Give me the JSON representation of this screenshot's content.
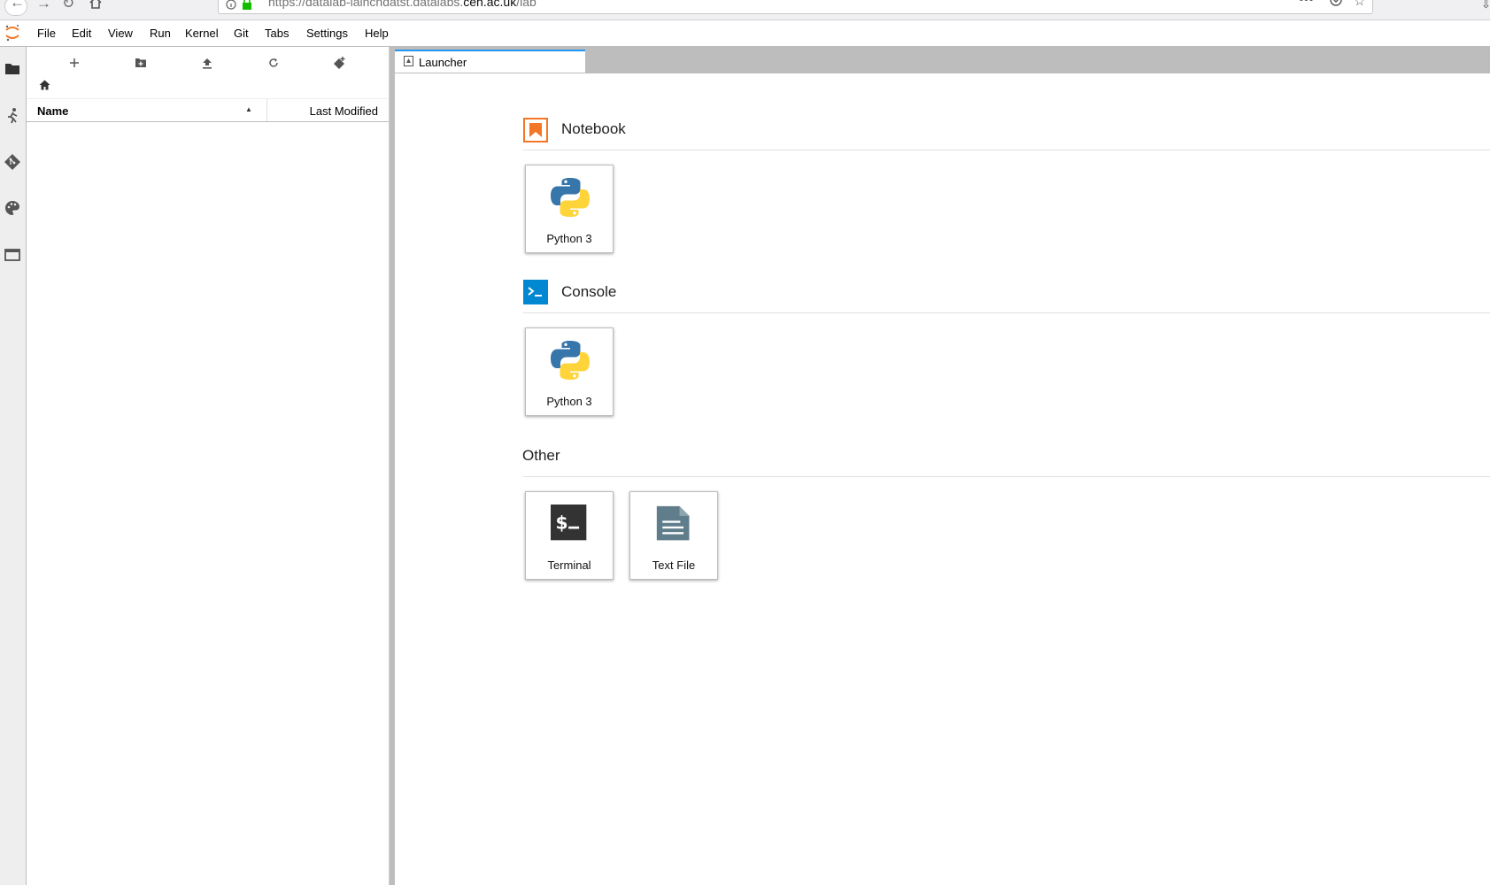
{
  "browser": {
    "url_prefix": "https://datalab-iaincndatst.datalabs.",
    "url_host": "ceh.ac.uk",
    "url_path": "/lab"
  },
  "menubar": {
    "items": [
      "File",
      "Edit",
      "View",
      "Run",
      "Kernel",
      "Git",
      "Tabs",
      "Settings",
      "Help"
    ]
  },
  "activity_bar": {
    "icons": [
      "folder-icon",
      "running-icon",
      "git-icon",
      "palette-icon",
      "tabs-icon"
    ]
  },
  "file_browser": {
    "toolbar": [
      "new-launcher-icon",
      "new-folder-icon",
      "upload-icon",
      "refresh-icon",
      "git-clone-icon"
    ],
    "breadcrumb_icon": "home-icon",
    "columns": {
      "name": "Name",
      "last_modified": "Last Modified"
    },
    "sort_indicator": "▲"
  },
  "tabs": [
    {
      "label": "Launcher",
      "active": true,
      "icon": "launcher-tab-icon"
    }
  ],
  "launcher": {
    "sections": [
      {
        "title": "Notebook",
        "icon": "notebook-icon",
        "cards": [
          {
            "label": "Python 3",
            "icon": "python-logo-icon"
          }
        ]
      },
      {
        "title": "Console",
        "icon": "console-icon",
        "cards": [
          {
            "label": "Python 3",
            "icon": "python-logo-icon"
          }
        ]
      },
      {
        "title": "Other",
        "icon": "",
        "cards": [
          {
            "label": "Terminal",
            "icon": "terminal-icon"
          },
          {
            "label": "Text File",
            "icon": "text-file-icon"
          }
        ]
      }
    ]
  },
  "colors": {
    "jupyter_orange": "#f37726",
    "console_blue": "#0288d1",
    "tab_accent": "#2196f3",
    "python_blue": "#3776ab",
    "python_yellow": "#ffd43b"
  }
}
